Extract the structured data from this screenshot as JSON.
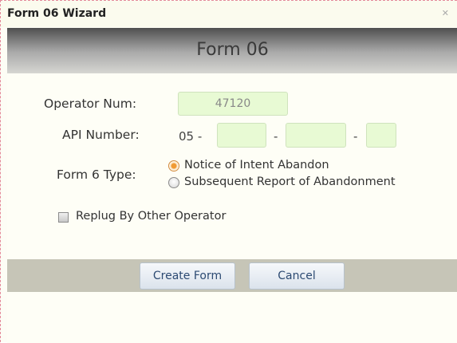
{
  "window": {
    "title": "Form 06 Wizard",
    "close_icon": "close-icon"
  },
  "header": {
    "title": "Form 06"
  },
  "form": {
    "operator_num": {
      "label": "Operator Num:",
      "value": "47120"
    },
    "api_number": {
      "label": "API Number:",
      "prefix": "05 -",
      "separator1": "-",
      "separator2": "-",
      "segment1": "",
      "segment2": "",
      "segment3": ""
    },
    "form6_type": {
      "label": "Form 6 Type:",
      "options": [
        {
          "label": "Notice of Intent Abandon",
          "selected": true
        },
        {
          "label": "Subsequent Report of Abandonment",
          "selected": false
        }
      ]
    },
    "replug": {
      "label": "Replug By Other Operator",
      "checked": false
    }
  },
  "buttons": {
    "create_label": "Create Form",
    "cancel_label": "Cancel"
  },
  "colors": {
    "field_bg": "#e8fad4",
    "footer_bg": "#c6c5b7",
    "radio_accent": "#f09a34",
    "button_text": "#2c4a72"
  }
}
